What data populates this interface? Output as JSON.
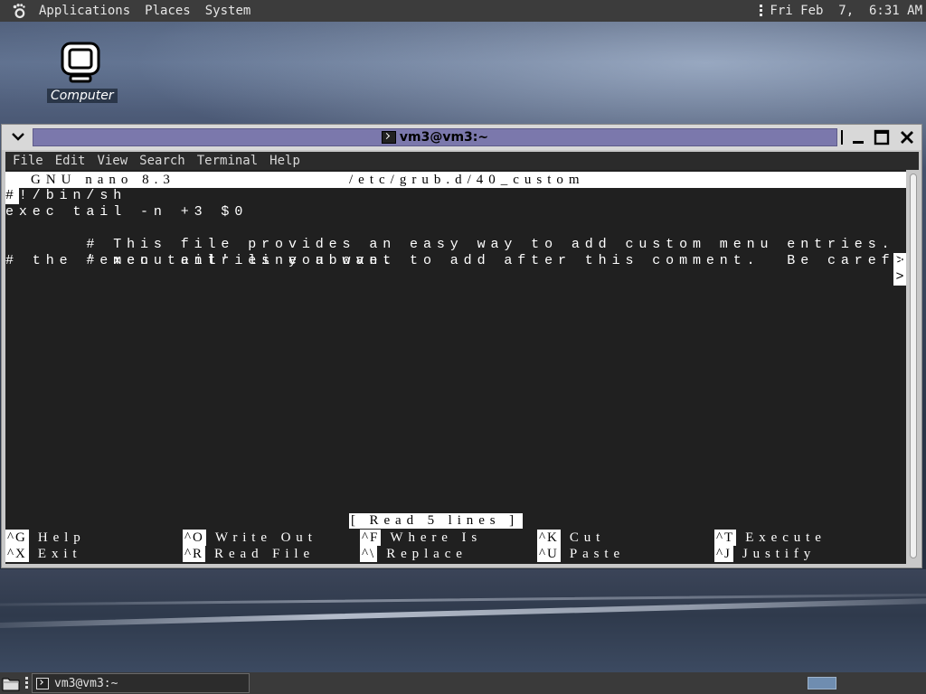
{
  "top_panel": {
    "menus": [
      "Applications",
      "Places",
      "System"
    ],
    "clock": "Fri Feb  7,  6:31 AM"
  },
  "desktop": {
    "icon_label": "Computer"
  },
  "window": {
    "title": "vm3@vm3:~",
    "menubar": [
      "File",
      "Edit",
      "View",
      "Search",
      "Terminal",
      "Help"
    ]
  },
  "nano": {
    "app_version": "GNU nano 8.3",
    "filename": "/etc/grub.d/40_custom",
    "cursor_char": "#",
    "lines": [
      "!/bin/sh",
      "exec tail -n +3 $0",
      "# This file provides an easy way to add custom menu entries.  Simply t",
      "# menu entries you want to add after this comment.  Be careful not to ",
      "# the 'exec tail' line above."
    ],
    "overflow_marker": ">",
    "status": "[ Read 5 lines ]",
    "shortcuts_row1": [
      {
        "key": "^G",
        "label": "Help"
      },
      {
        "key": "^O",
        "label": "Write Out"
      },
      {
        "key": "^F",
        "label": "Where Is"
      },
      {
        "key": "^K",
        "label": "Cut"
      },
      {
        "key": "^T",
        "label": "Execute"
      }
    ],
    "shortcuts_row2": [
      {
        "key": "^X",
        "label": "Exit"
      },
      {
        "key": "^R",
        "label": "Read File"
      },
      {
        "key": "^\\",
        "label": "Replace"
      },
      {
        "key": "^U",
        "label": "Paste"
      },
      {
        "key": "^J",
        "label": "Justify"
      }
    ]
  },
  "taskbar": {
    "task_label": "vm3@vm3:~"
  },
  "colors": {
    "title_strip": "#7b78ac",
    "terminal_bg": "#202020",
    "panel_bg": "#3c3c3c"
  },
  "icons": [
    "gnome-foot-icon",
    "computer-icon",
    "window-menu-icon",
    "terminal-icon",
    "minimize-icon",
    "maximize-icon",
    "close-icon",
    "show-desktop-icon",
    "workspace-switcher"
  ]
}
